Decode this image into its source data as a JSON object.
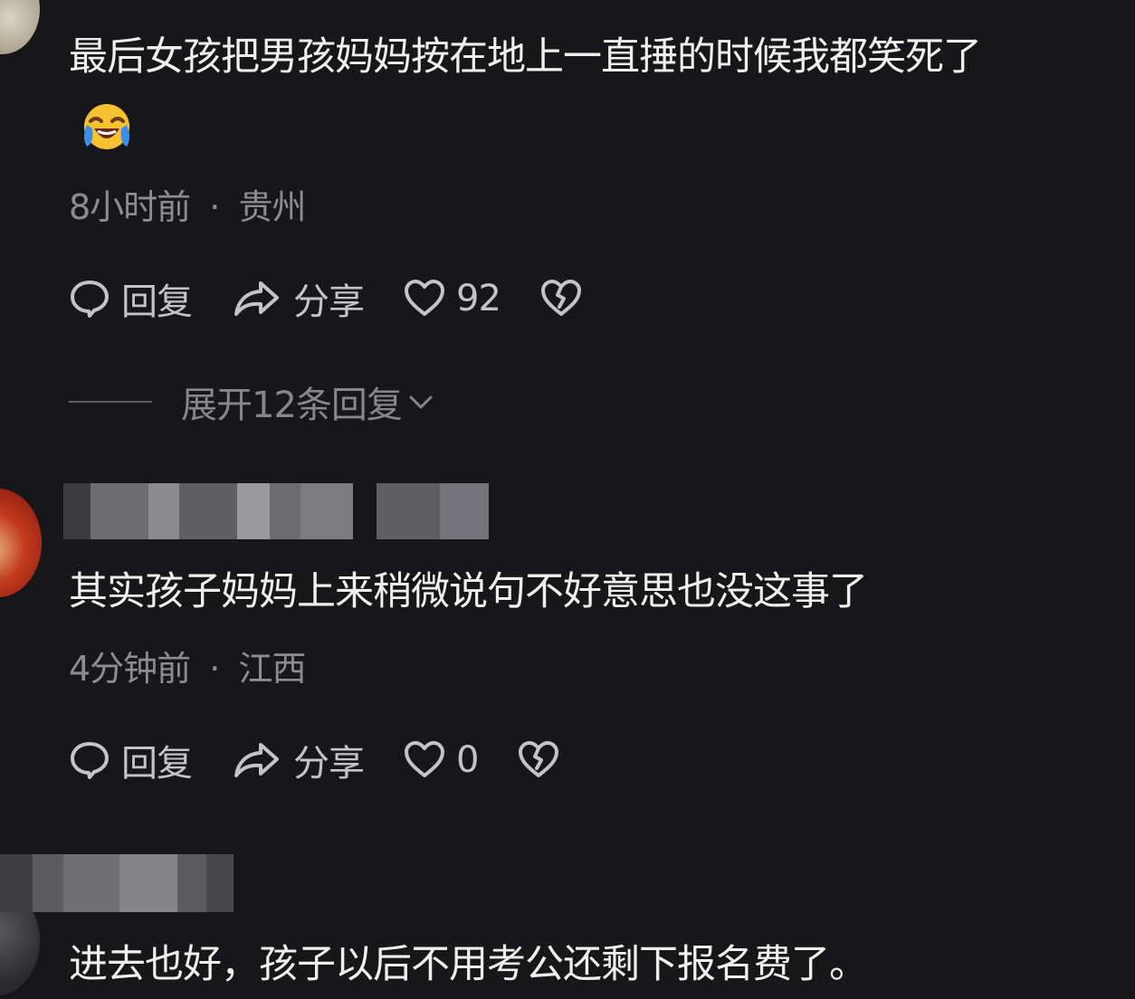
{
  "comments": [
    {
      "text": "最后女孩把男孩妈妈按在地上一直捶的时候我都笑死了",
      "emoji": "laughing-crying-emoji",
      "time": "8小时前",
      "location": "贵州",
      "reply_label": "回复",
      "share_label": "分享",
      "likes": "92",
      "expand_label": "展开12条回复"
    },
    {
      "text": "其实孩子妈妈上来稍微说句不好意思也没这事了",
      "time": "4分钟前",
      "location": "江西",
      "reply_label": "回复",
      "share_label": "分享",
      "likes": "0"
    },
    {
      "text": "进去也好，孩子以后不用考公还剩下报名费了。"
    }
  ],
  "separator": "·",
  "colors": {
    "background": "#17171a",
    "text": "#efefef",
    "meta": "#8c8c91",
    "icon": "#b9b9bd"
  },
  "icons": [
    "comment-bubble-icon",
    "share-arrow-icon",
    "heart-icon",
    "broken-heart-icon",
    "chevron-down-icon"
  ]
}
